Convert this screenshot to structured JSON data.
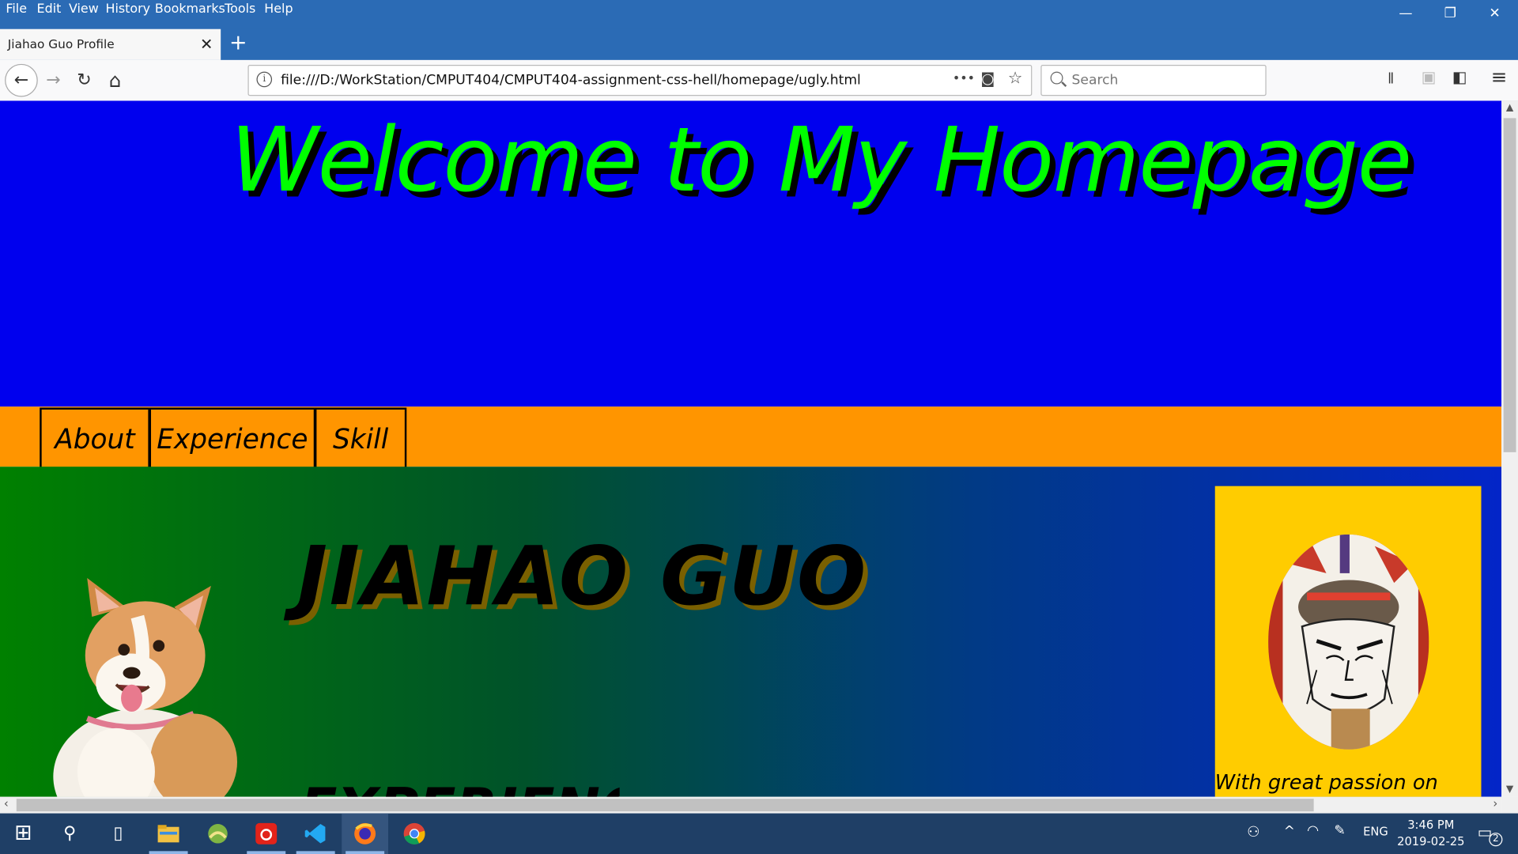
{
  "menu": [
    "File",
    "Edit",
    "View",
    "History",
    "Bookmarks",
    "Tools",
    "Help"
  ],
  "window_controls": {
    "minimize": "—",
    "restore": "❐",
    "close": "✕"
  },
  "tab": {
    "title": "Jiahao Guo Profile",
    "close": "✕",
    "new_tab": "+"
  },
  "nav": {
    "back": "←",
    "forward": "→",
    "reload": "↻",
    "home": "⌂"
  },
  "url": {
    "info": "i",
    "text": "file:///D:/WorkStation/CMPUT404/CMPUT404-assignment-css-hell/homepage/ugly.html",
    "more": "•••",
    "pocket": "◙",
    "bookmark": "☆"
  },
  "search": {
    "placeholder": "Search"
  },
  "toolbar_right": {
    "library": "𝍪",
    "extension": "▣",
    "sidebar": "◧",
    "menu": "≡"
  },
  "page": {
    "heading": "Welcome to My Homepage",
    "nav_items": [
      "About",
      "Experience",
      "Skill"
    ],
    "name": "JIAHAO GUO",
    "cut_heading": "EXPERIENCE",
    "side_text": "With great passion on"
  },
  "taskbar": {
    "start": "⊞",
    "search": "⚲",
    "task_view": "▯",
    "apps": [
      "file-explorer",
      "app-green",
      "netease-music",
      "vscode",
      "firefox",
      "chrome"
    ],
    "tray_lang": "ENG",
    "time": "3:46 PM",
    "date": "2019-02-25",
    "notifications": "2"
  },
  "colors": {
    "hero_bg": "#0000ee",
    "heading": "#00ff00",
    "nav_bg": "#ff9500",
    "gradient_start": "#008000",
    "gradient_end": "#0325c8",
    "card_bg": "#ffcc00"
  }
}
